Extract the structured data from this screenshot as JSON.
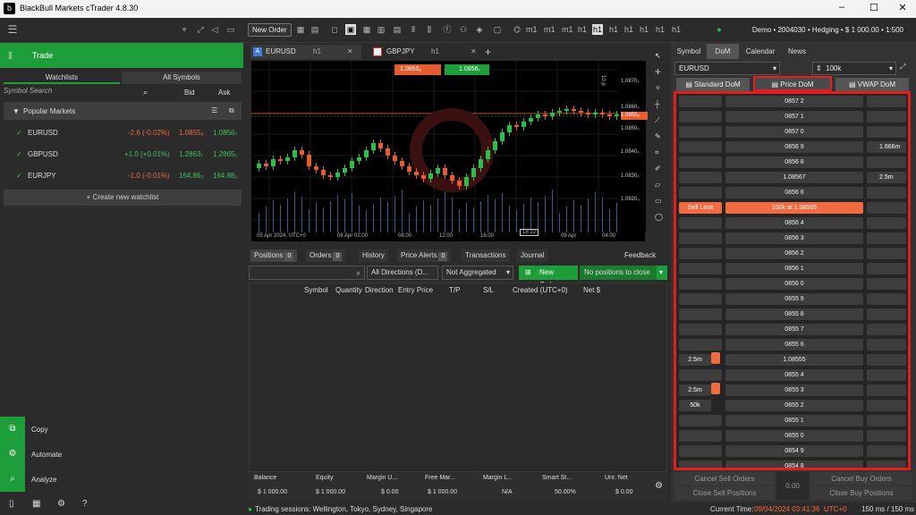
{
  "app": {
    "title": "BlackBull Markets cTrader 4.8.30",
    "win_min": "–",
    "win_max": "☐",
    "win_close": "✕"
  },
  "toolbar": {
    "new_order": "New Order",
    "account": "Demo • 2004030 • Hedging • $ 1 000.00 • 1:500",
    "timeframes": [
      "m1",
      "m1",
      "m1",
      "h1",
      "h1",
      "h1",
      "h1",
      "h1",
      "h1",
      "h1"
    ]
  },
  "left": {
    "trade": "Trade",
    "tab_watchlists": "Watchlists",
    "tab_all": "All Symbols",
    "search_placeholder": "Symbol Search",
    "col_bid": "Bid",
    "col_ask": "Ask",
    "popular": "Popular Markets",
    "rows": [
      {
        "sym": "EURUSD",
        "chg": "-2.6 (-0.02%)",
        "bid": "1.0855₈",
        "ask": "1.0856₇",
        "neg": true
      },
      {
        "sym": "GBPUSD",
        "chg": "+1.0 (+0.01%)",
        "bid": "1.2863₇",
        "ask": "1.2865₁",
        "neg": false
      },
      {
        "sym": "EURJPY",
        "chg": "-1.0 (-0.01%)",
        "bid": "164.86₂",
        "ask": "164.88₂",
        "neg": true
      }
    ],
    "create": "+ Create new watchlist",
    "copy": "Copy",
    "automate": "Automate",
    "analyze": "Analyze"
  },
  "chart": {
    "tab1": "EURUSD",
    "tab1_tf": "h1",
    "tab2": "GBPJPY",
    "tab2_tf": "h1",
    "sell_box": "1.0855₈",
    "buy_box": "1.0856₇",
    "tf_label": "10 p",
    "prices": [
      "1.0870₀",
      "1.0860₀",
      "1.0855₈",
      "1.0850₀",
      "1.0840₀",
      "1.0830₀",
      "1.0820₀"
    ],
    "times": [
      "05 Apr 2024, UTC+0",
      "08 Apr 02:00",
      "08:00",
      "12:00",
      "16:00",
      "09 Apr",
      "04:00"
    ],
    "cross_time": "18:22"
  },
  "positions": {
    "tabs": [
      {
        "l": "Positions",
        "n": "0"
      },
      {
        "l": "Orders",
        "n": "0"
      },
      {
        "l": "History",
        "n": ""
      },
      {
        "l": "Price Alerts",
        "n": "0"
      },
      {
        "l": "Transactions",
        "n": ""
      },
      {
        "l": "Journal",
        "n": ""
      }
    ],
    "feedback": "Feedback",
    "directions": "All Directions (D...",
    "aggr": "Not Aggregated",
    "new_order": "New Order",
    "close_all": "No positions to close",
    "cols": [
      "Symbol",
      "Quantity",
      "Direction",
      "Entry Price",
      "T/P",
      "S/L",
      "Created (UTC+0)",
      "Net $"
    ],
    "summary": [
      {
        "l": "Balance",
        "v": "$ 1 000.00"
      },
      {
        "l": "Equity",
        "v": "$ 1 000.00"
      },
      {
        "l": "Margin U...",
        "v": "$ 0.00"
      },
      {
        "l": "Free Mar...",
        "v": "$ 1 000.00"
      },
      {
        "l": "Margin L...",
        "v": "N/A"
      },
      {
        "l": "Smart St...",
        "v": "50.00%"
      },
      {
        "l": "Unr. Net",
        "v": "$ 0.00"
      }
    ]
  },
  "status": {
    "sessions": "Trading sessions: Wellington, Tokyo, Sydney, Singapore",
    "time_label": "Current Time:",
    "time": "09/04/2024 03:41:36",
    "tz": "UTC+0",
    "latency": "150 ms / 150 ms"
  },
  "dom": {
    "tabs": [
      "Symbol",
      "DoM",
      "Calendar",
      "News"
    ],
    "symbol": "EURUSD",
    "volume": "100k",
    "t_standard": "Standard DoM",
    "t_price": "Price DoM",
    "t_vwap": "VWAP DoM",
    "rows": [
      {
        "p": "0857 2",
        "l": "",
        "r": ""
      },
      {
        "p": "0857 1",
        "l": "",
        "r": ""
      },
      {
        "p": "0857 0",
        "l": "",
        "r": ""
      },
      {
        "p": "0856 9",
        "l": "",
        "r": "1.666m"
      },
      {
        "p": "0856 8",
        "l": "",
        "r": ""
      },
      {
        "p": "1.08567",
        "l": "",
        "r": "2.5m"
      },
      {
        "p": "0856 6",
        "l": "",
        "r": ""
      },
      {
        "p": "100k at 1.08565",
        "l": "Sell Limit",
        "r": "",
        "hl": true
      },
      {
        "p": "0856 4",
        "l": "",
        "r": ""
      },
      {
        "p": "0856 3",
        "l": "",
        "r": ""
      },
      {
        "p": "0856 2",
        "l": "",
        "r": ""
      },
      {
        "p": "0856 1",
        "l": "",
        "r": ""
      },
      {
        "p": "0856 0",
        "l": "",
        "r": ""
      },
      {
        "p": "0855 9",
        "l": "",
        "r": ""
      },
      {
        "p": "0855 8",
        "l": "",
        "r": ""
      },
      {
        "p": "0855 7",
        "l": "",
        "r": ""
      },
      {
        "p": "0855 6",
        "l": "",
        "r": ""
      },
      {
        "p": "1.08555",
        "l": "2.5m",
        "r": ""
      },
      {
        "p": "0855 4",
        "l": "",
        "r": ""
      },
      {
        "p": "0855 3",
        "l": "2.5m",
        "r": ""
      },
      {
        "p": "0855 2",
        "l": "50k",
        "r": ""
      },
      {
        "p": "0855 1",
        "l": "",
        "r": ""
      },
      {
        "p": "0855 0",
        "l": "",
        "r": ""
      },
      {
        "p": "0854 9",
        "l": "",
        "r": ""
      },
      {
        "p": "0854 8",
        "l": "",
        "r": ""
      }
    ],
    "cancel_sell": "Cancel Sell Orders",
    "close_sell": "Close Sell Positions",
    "net": "0.00",
    "cancel_buy": "Cancel Buy Orders",
    "close_buy": "Close Buy Positions"
  },
  "colors": {
    "green": "#1e9e3a",
    "red": "#e41e1e",
    "orange": "#f26a3f"
  }
}
